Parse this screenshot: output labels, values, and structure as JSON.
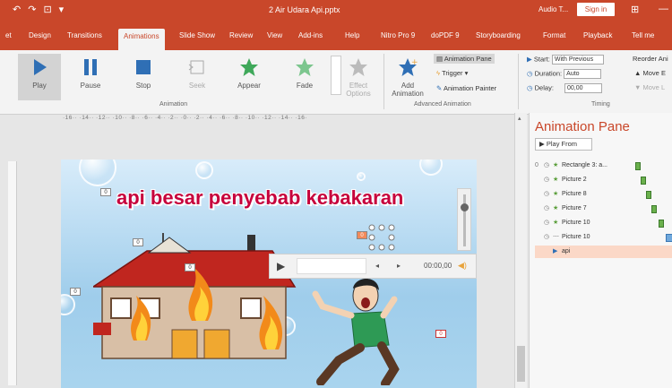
{
  "window": {
    "title": "2 Air Udara Api.pptx",
    "qat": [
      "↶",
      "↷",
      "⊡",
      "▾"
    ],
    "user": "Audio T...",
    "signin": "Sign in",
    "winbtns": [
      "⊞",
      "—"
    ]
  },
  "tabs": [
    "et",
    "Design",
    "Transitions",
    "Animations",
    "Slide Show",
    "Review",
    "View",
    "Add-ins",
    "Help",
    "Nitro Pro 9",
    "doPDF 9",
    "Storyboarding",
    "Format",
    "Playback",
    "Tell me"
  ],
  "ribbon": {
    "buttons": [
      "Play",
      "Pause",
      "Stop",
      "Seek",
      "Appear",
      "Fade"
    ],
    "effect_options": [
      "Effect",
      "Options"
    ],
    "add_animation": [
      "Add",
      "Animation"
    ],
    "anim_pane": "Animation Pane",
    "trigger": "Trigger",
    "painter": "Animation Painter",
    "start_label": "Start:",
    "start_val": "With Previous",
    "duration_label": "Duration:",
    "duration_val": "Auto",
    "delay_label": "Delay:",
    "delay_val": "00,00",
    "reorder": "Reorder Ani",
    "move_earlier": "Move E",
    "move_later": "Move L",
    "groups": [
      "Animation",
      "Advanced Animation",
      "Timing"
    ]
  },
  "ruler": "·16·· ·14·· ·12·· ·10·· ·8·· ·6·· ·4·· ·2·· ·0·· ·2·· ·4·· ·6·· ·8·· ·10·· ·12·· ·14·· ·16·",
  "slide": {
    "title": "api besar penyebab kebakaran",
    "tags": [
      "0",
      "0",
      "0",
      "0",
      "0",
      "0"
    ],
    "time": "00:00,00"
  },
  "pane": {
    "title": "Animation Pane",
    "play_from": "▶ Play From",
    "items": [
      {
        "num": "0",
        "name": "Rectangle 3: a...",
        "bar": "1"
      },
      {
        "num": "",
        "name": "Picture 2",
        "bar": "2"
      },
      {
        "num": "",
        "name": "Picture 8",
        "bar": "3"
      },
      {
        "num": "",
        "name": "Picture 7",
        "bar": "4"
      },
      {
        "num": "",
        "name": "Picture 10",
        "bar": "5"
      },
      {
        "num": "",
        "name": "Picture 10",
        "bar": "6"
      },
      {
        "num": "",
        "name": "api",
        "bar": "7"
      }
    ]
  },
  "colors": {
    "accent": "#c9472a",
    "title_red": "#c6003c",
    "green": "#5a9e3a"
  }
}
